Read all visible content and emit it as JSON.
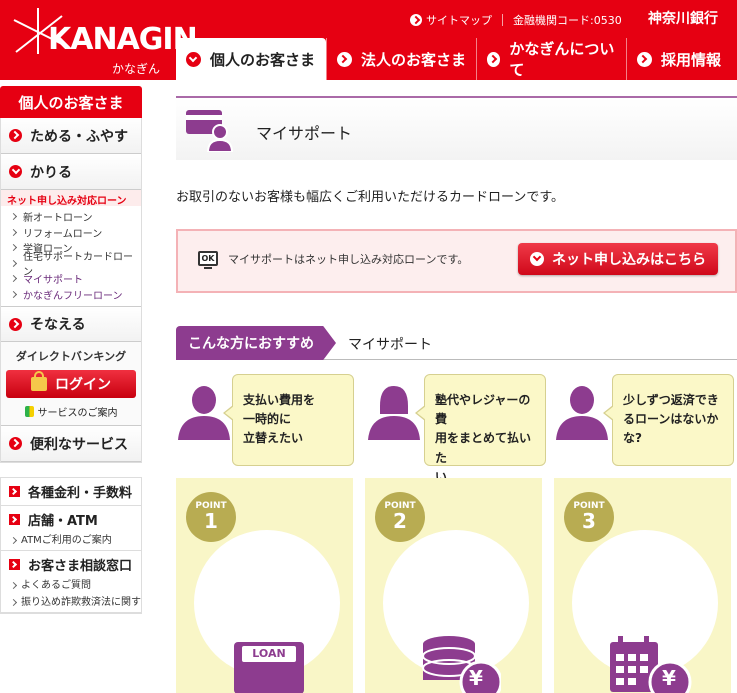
{
  "header": {
    "logo_text": "KANAGIN",
    "logo_kana": "かなぎん",
    "top_links": [
      "サイトマップ",
      "金融機関コード:0530"
    ],
    "bank_name": "神奈川銀行",
    "tabs": [
      {
        "label": "個人のお客さま",
        "active": true
      },
      {
        "label": "法人のお客さま",
        "active": false
      },
      {
        "label": "かなぎんについて",
        "active": false
      },
      {
        "label": "採用情報",
        "active": false
      }
    ]
  },
  "sidebar": {
    "heading": "個人のお客さま",
    "items": [
      "ためる・ふやす",
      "かりる"
    ],
    "net_label": "ネット申し込み対応ローン",
    "sub_items": [
      "新オートローン",
      "リフォームローン",
      "学資ローン",
      "住宅サポートカードローン",
      "マイサポート",
      "かなぎんフリーローン"
    ],
    "item_sonaeru": "そなえる",
    "direct_label": "ダイレクトバンキング",
    "login_label": "ログイン",
    "service_guide": "サービスのご案内",
    "item_benri": "便利なサービス",
    "bottom_items": [
      {
        "label": "各種金利・手数料",
        "sub": []
      },
      {
        "label": "店舗・ATM",
        "sub": [
          "ATMご利用のご案内"
        ]
      },
      {
        "label": "お客さま相談窓口",
        "sub": [
          "よくあるご質問",
          "振り込め詐欺救済法に関す"
        ]
      }
    ]
  },
  "main": {
    "page_title": "マイサポート",
    "lead": "お取引のないお客様も幅広くご利用いただけるカードローンです。",
    "notice_icon": "OK",
    "notice_text": "マイサポートはネット申し込み対応ローンです。",
    "apply_button": "ネット申し込みはこちら",
    "rec_tag": "こんな方におすすめ",
    "rec_title": "マイサポート",
    "bubbles": [
      [
        "支払い費用を",
        "一時的に",
        "立替えたい"
      ],
      [
        "塾代やレジャーの費",
        "用をまとめて払いた",
        "い"
      ],
      [
        "少しずつ返済でき",
        "るローンはないか",
        "な?"
      ]
    ],
    "points": [
      {
        "label": "POINT",
        "num": "1",
        "icon_text": "LOAN"
      },
      {
        "label": "POINT",
        "num": "2",
        "icon_text": "¥"
      },
      {
        "label": "POINT",
        "num": "3",
        "icon_text": "¥"
      }
    ]
  },
  "colors": {
    "brand_red": "#e60012",
    "accent_purple": "#8d3c8f",
    "bubble_yellow": "#fbf8c8"
  }
}
